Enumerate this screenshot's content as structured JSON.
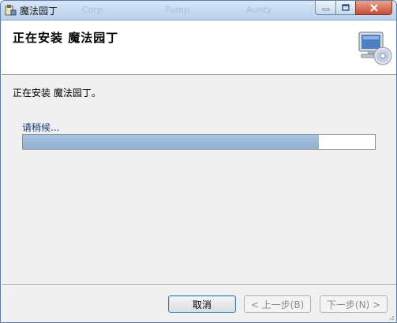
{
  "window": {
    "title": "魔法园丁",
    "ghost_tabs": [
      "Corp",
      "Pump",
      "Aunty"
    ]
  },
  "header": {
    "title": "正在安装 魔法园丁"
  },
  "body": {
    "message": "正在安装 魔法园丁。",
    "wait_label": "请稍候...",
    "progress_fraction": 0.84
  },
  "buttons": {
    "cancel": "取消",
    "back": "< 上一步(B)",
    "next": "下一步(N) >"
  },
  "icons": {
    "app": "installer-icon",
    "header": "computer-cd-icon",
    "minimize": "minimize-icon",
    "maximize": "maximize-icon",
    "close": "close-icon"
  }
}
